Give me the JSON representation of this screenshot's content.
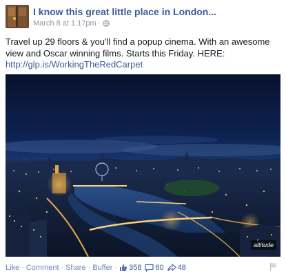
{
  "post": {
    "page_name": "I know this great little place in London...",
    "date": "March 8 at 1:17pm",
    "meta_separator": "·",
    "privacy_icon": "globe-icon",
    "text_line": "Travel up 29 floors & you'll find a popup cinema. With an awesome view and Oscar winning films. Starts this Friday. HERE:",
    "link": "http://glp.is/WorkingTheRedCarpet",
    "photo": {
      "description_icon": "london-night-skyline-photo",
      "watermark": "altitude"
    }
  },
  "actions": {
    "like": "Like",
    "comment": "Comment",
    "share": "Share",
    "buffer": "Buffer",
    "separator": "·",
    "likes_count": "358",
    "comments_count": "60",
    "shares_count": "48"
  },
  "colors": {
    "link_blue": "#3b5998",
    "action_blue": "#6d84b4",
    "meta_gray": "#9197a3"
  }
}
